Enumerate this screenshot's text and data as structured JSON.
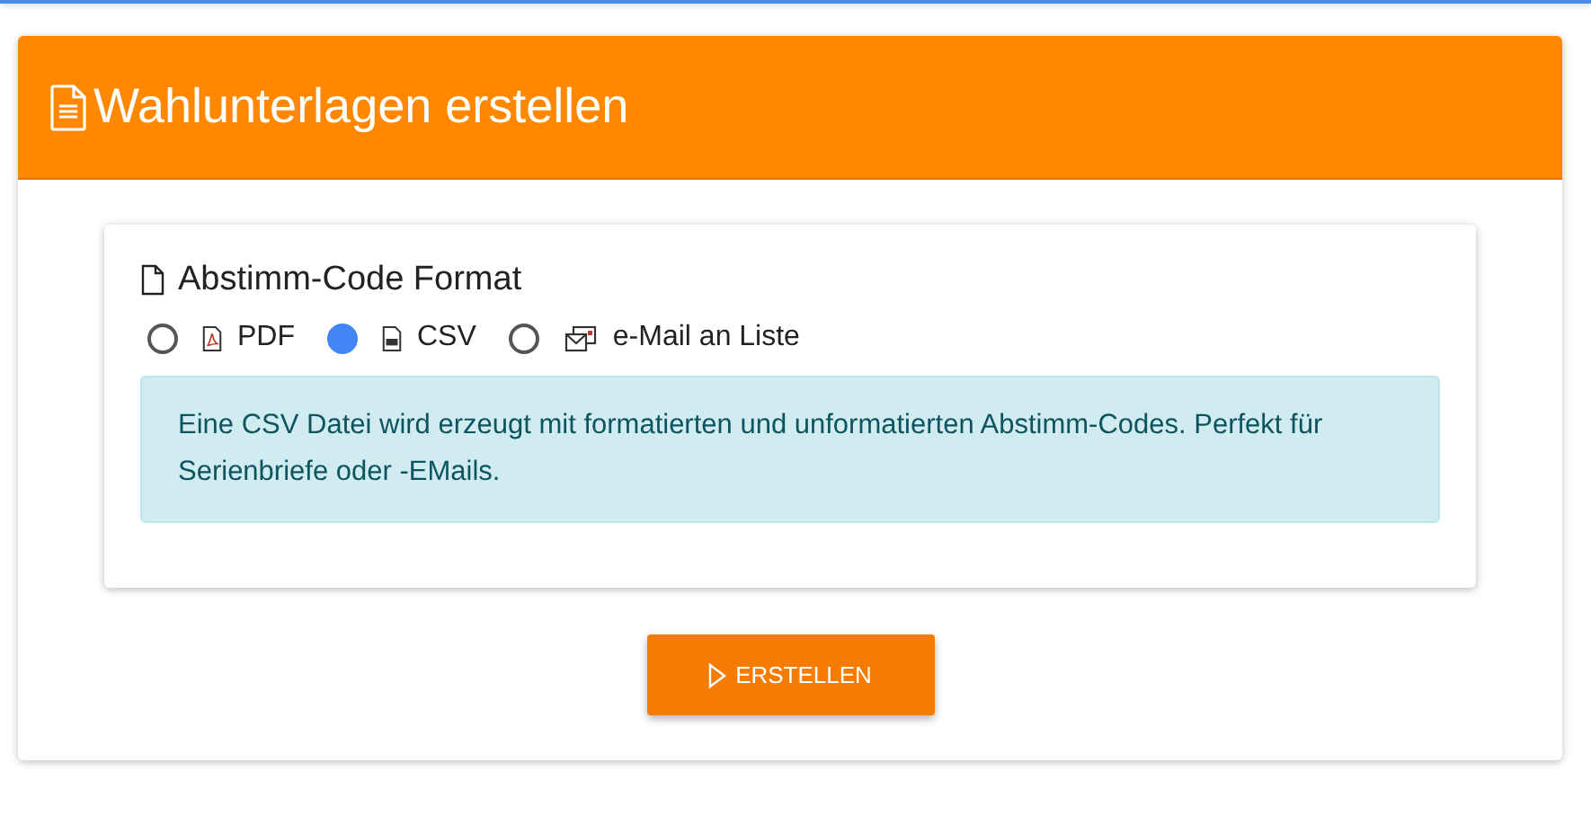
{
  "header": {
    "title": "Wahlunterlagen erstellen"
  },
  "format_card": {
    "title": "Abstimm-Code Format",
    "options": [
      {
        "kind": "pdf",
        "label": "PDF",
        "selected": false
      },
      {
        "kind": "csv",
        "label": "CSV",
        "selected": true
      },
      {
        "kind": "mail",
        "label": "e-Mail an Liste",
        "selected": false
      }
    ],
    "info": "Eine CSV Datei wird erzeugt mit formatierten und unformatierten Abstimm-Codes. Perfekt für Serienbriefe oder -EMails."
  },
  "button": "ERSTELLEN"
}
